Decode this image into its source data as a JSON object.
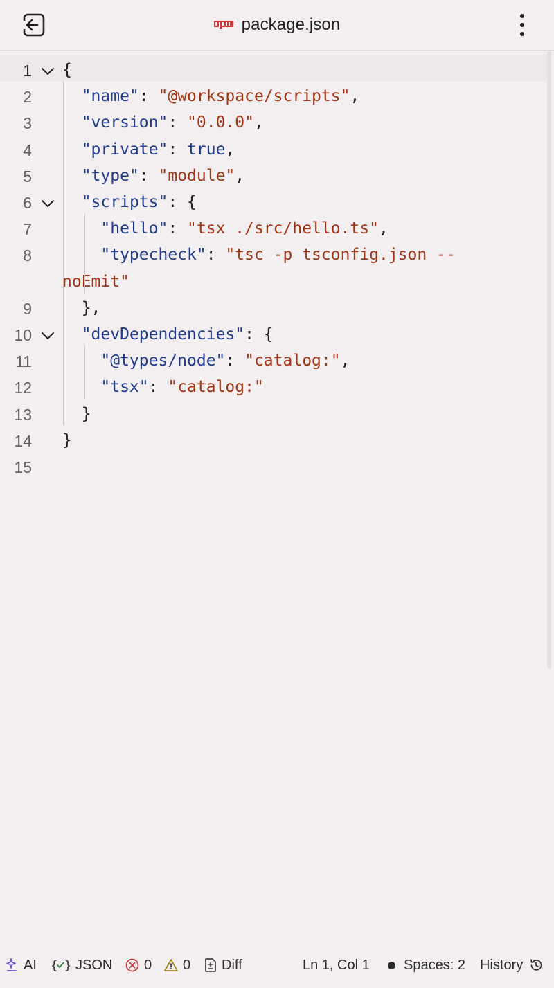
{
  "header": {
    "title": "package.json",
    "file_icon": "npm-icon"
  },
  "editor": {
    "lines": [
      {
        "num": "1",
        "foldable": true,
        "tokens": [
          {
            "t": "{",
            "c": "p"
          }
        ]
      },
      {
        "num": "2",
        "foldable": false,
        "tokens": [
          {
            "t": "  ",
            "c": "p"
          },
          {
            "t": "\"name\"",
            "c": "k"
          },
          {
            "t": ": ",
            "c": "p"
          },
          {
            "t": "\"@workspace/scripts\"",
            "c": "s"
          },
          {
            "t": ",",
            "c": "p"
          }
        ]
      },
      {
        "num": "3",
        "foldable": false,
        "tokens": [
          {
            "t": "  ",
            "c": "p"
          },
          {
            "t": "\"version\"",
            "c": "k"
          },
          {
            "t": ": ",
            "c": "p"
          },
          {
            "t": "\"0.0.0\"",
            "c": "s"
          },
          {
            "t": ",",
            "c": "p"
          }
        ]
      },
      {
        "num": "4",
        "foldable": false,
        "tokens": [
          {
            "t": "  ",
            "c": "p"
          },
          {
            "t": "\"private\"",
            "c": "k"
          },
          {
            "t": ": ",
            "c": "p"
          },
          {
            "t": "true",
            "c": "k"
          },
          {
            "t": ",",
            "c": "p"
          }
        ]
      },
      {
        "num": "5",
        "foldable": false,
        "tokens": [
          {
            "t": "  ",
            "c": "p"
          },
          {
            "t": "\"type\"",
            "c": "k"
          },
          {
            "t": ": ",
            "c": "p"
          },
          {
            "t": "\"module\"",
            "c": "s"
          },
          {
            "t": ",",
            "c": "p"
          }
        ]
      },
      {
        "num": "6",
        "foldable": true,
        "tokens": [
          {
            "t": "  ",
            "c": "p"
          },
          {
            "t": "\"scripts\"",
            "c": "k"
          },
          {
            "t": ": {",
            "c": "p"
          }
        ]
      },
      {
        "num": "7",
        "foldable": false,
        "tokens": [
          {
            "t": "    ",
            "c": "p"
          },
          {
            "t": "\"hello\"",
            "c": "k"
          },
          {
            "t": ": ",
            "c": "p"
          },
          {
            "t": "\"tsx ./src/hello.ts\"",
            "c": "s"
          },
          {
            "t": ",",
            "c": "p"
          }
        ]
      },
      {
        "num": "8",
        "foldable": false,
        "tokens": [
          {
            "t": "    ",
            "c": "p"
          },
          {
            "t": "\"typecheck\"",
            "c": "k"
          },
          {
            "t": ": ",
            "c": "p"
          },
          {
            "t": "\"tsc -p tsconfig.json --",
            "c": "s"
          }
        ]
      },
      {
        "num": "",
        "foldable": false,
        "tokens": [
          {
            "t": "noEmit\"",
            "c": "s"
          }
        ]
      },
      {
        "num": "9",
        "foldable": false,
        "tokens": [
          {
            "t": "  ",
            "c": "p"
          },
          {
            "t": "},",
            "c": "p"
          }
        ]
      },
      {
        "num": "10",
        "foldable": true,
        "tokens": [
          {
            "t": "  ",
            "c": "p"
          },
          {
            "t": "\"devDependencies\"",
            "c": "k"
          },
          {
            "t": ": {",
            "c": "p"
          }
        ]
      },
      {
        "num": "11",
        "foldable": false,
        "tokens": [
          {
            "t": "    ",
            "c": "p"
          },
          {
            "t": "\"@types/node\"",
            "c": "k"
          },
          {
            "t": ": ",
            "c": "p"
          },
          {
            "t": "\"catalog:\"",
            "c": "s"
          },
          {
            "t": ",",
            "c": "p"
          }
        ]
      },
      {
        "num": "12",
        "foldable": false,
        "tokens": [
          {
            "t": "    ",
            "c": "p"
          },
          {
            "t": "\"tsx\"",
            "c": "k"
          },
          {
            "t": ": ",
            "c": "p"
          },
          {
            "t": "\"catalog:\"",
            "c": "s"
          }
        ]
      },
      {
        "num": "13",
        "foldable": false,
        "tokens": [
          {
            "t": "  ",
            "c": "p"
          },
          {
            "t": "}",
            "c": "p"
          }
        ]
      },
      {
        "num": "14",
        "foldable": false,
        "tokens": [
          {
            "t": "}",
            "c": "p"
          }
        ]
      },
      {
        "num": "15",
        "foldable": false,
        "tokens": []
      }
    ]
  },
  "statusbar": {
    "ai_label": "AI",
    "language_label": "JSON",
    "errors_count": "0",
    "warnings_count": "0",
    "diff_label": "Diff",
    "cursor_position": "Ln 1, Col 1",
    "indent_label": "Spaces: 2",
    "history_label": "History"
  },
  "colors": {
    "key": "#1e3c8c",
    "string": "#a33412",
    "background": "#f3eff0",
    "ai_accent": "#6b4fd8",
    "error": "#c0282d"
  }
}
